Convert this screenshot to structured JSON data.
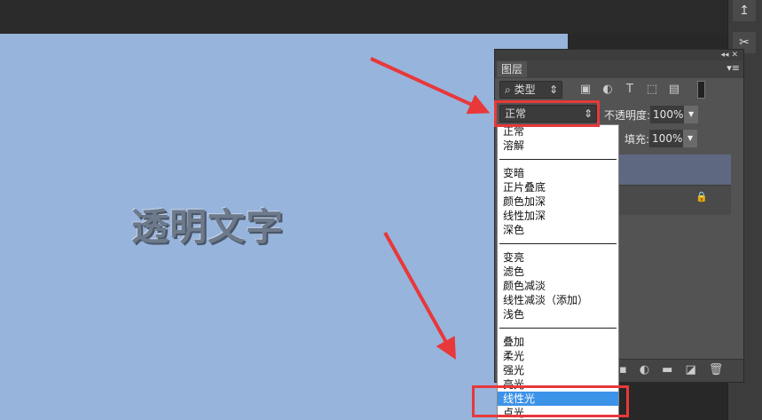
{
  "canvas": {
    "text": "透明文字",
    "background": "#97b4dc"
  },
  "tools": [
    "↥",
    "✂"
  ],
  "panel": {
    "collapse": "◂◂",
    "close": "✕",
    "tab": "图层",
    "menu": "▾≡",
    "filter": {
      "search_icon": "⌕",
      "value": "类型",
      "arrows": "⇕"
    },
    "filter_icons": [
      "▣",
      "◐",
      "T",
      "⬚",
      "▤"
    ],
    "blend_mode": "正常",
    "blend_arrows": "⇕",
    "opacity_label": "不透明度:",
    "opacity": "100%",
    "fill_label": "填充:",
    "fill": "100%",
    "lock_icon": "🔒",
    "bottom_icons": [
      "▪",
      "◐",
      "▬",
      "◪",
      "🗑"
    ]
  },
  "dropdown": {
    "groups": [
      [
        "正常",
        "溶解"
      ],
      [
        "变暗",
        "正片叠底",
        "颜色加深",
        "线性加深",
        "深色"
      ],
      [
        "变亮",
        "滤色",
        "颜色减淡",
        "线性减淡（添加）",
        "浅色"
      ],
      [
        "叠加",
        "柔光",
        "强光",
        "亮光",
        "线性光",
        "点光"
      ]
    ],
    "selected": "线性光"
  },
  "colors": {
    "highlight": "#e8383a",
    "selection": "#3d93e8"
  }
}
